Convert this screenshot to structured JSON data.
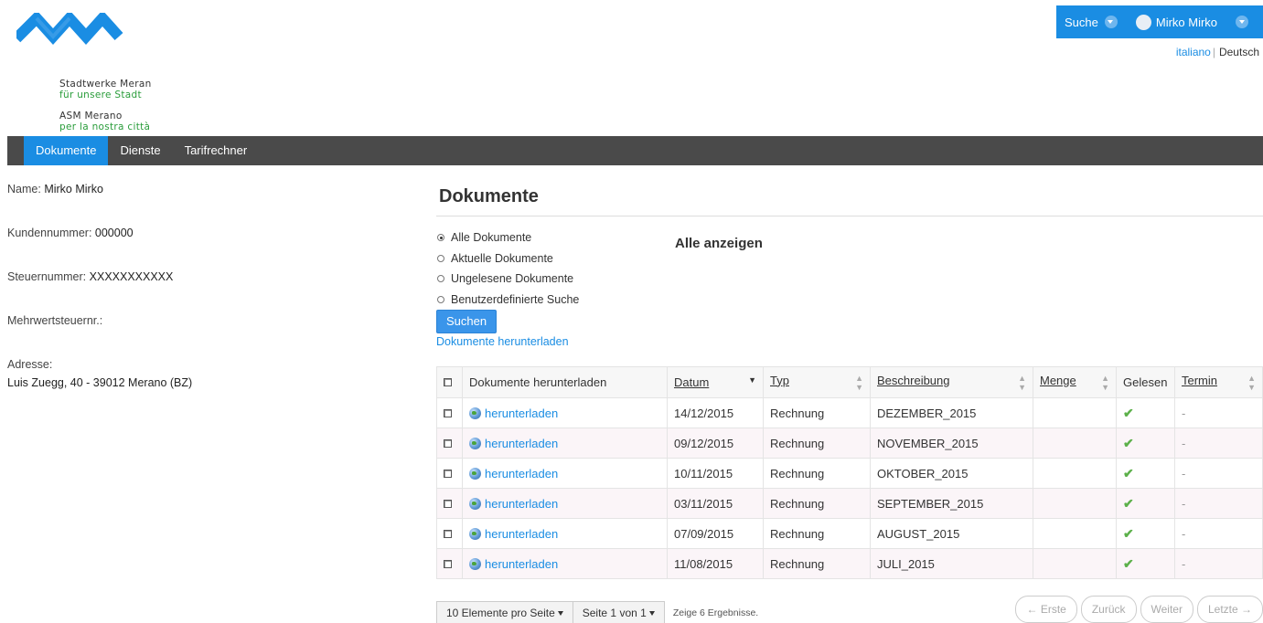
{
  "brand": {
    "line1": "Stadtwerke Meran",
    "line2": "für unsere Stadt",
    "line3": "ASM Merano",
    "line4": "per la nostra città",
    "color_blue": "#1a8de3",
    "color_green": "#2a9d3b"
  },
  "topbar": {
    "search_label": "Suche",
    "user_name": "Mirko Mirko",
    "lang_it": "italiano",
    "lang_de": "Deutsch"
  },
  "nav": {
    "items": [
      "Dokumente",
      "Dienste",
      "Tarifrechner"
    ]
  },
  "customer": {
    "name_label": "Name:",
    "name_value": "Mirko Mirko",
    "customer_no_label": "Kundennummer:",
    "customer_no_value": "000000",
    "tax_no_label": "Steuernummer:",
    "tax_no_value": "XXXXXXXXXXX",
    "vat_label": "Mehrwertsteuernr.:",
    "address_label": "Adresse:",
    "address_value": "Luis Zuegg, 40 - 39012 Merano (BZ)"
  },
  "main": {
    "title": "Dokumente",
    "filters": [
      "Alle Dokumente",
      "Aktuelle Dokumente",
      "Ungelesene Dokumente",
      "Benutzerdefinierte Suche"
    ],
    "selected_filter": "Alle Dokumente",
    "filter_heading": "Alle anzeigen",
    "search_button": "Suchen",
    "download_link": "Dokumente herunterladen"
  },
  "table": {
    "columns": [
      "Dokumente herunterladen",
      "Datum",
      "Typ",
      "Beschreibung",
      "Menge",
      "Gelesen",
      "Termin"
    ],
    "rows": [
      {
        "link": "herunterladen",
        "date": "14/12/2015",
        "type": "Rechnung",
        "desc": "DEZEMBER_2015",
        "qty": "",
        "read": "✔",
        "due": "-"
      },
      {
        "link": "herunterladen",
        "date": "09/12/2015",
        "type": "Rechnung",
        "desc": "NOVEMBER_2015",
        "qty": "",
        "read": "✔",
        "due": "-"
      },
      {
        "link": "herunterladen",
        "date": "10/11/2015",
        "type": "Rechnung",
        "desc": "OKTOBER_2015",
        "qty": "",
        "read": "✔",
        "due": "-"
      },
      {
        "link": "herunterladen",
        "date": "03/11/2015",
        "type": "Rechnung",
        "desc": "SEPTEMBER_2015",
        "qty": "",
        "read": "✔",
        "due": "-"
      },
      {
        "link": "herunterladen",
        "date": "07/09/2015",
        "type": "Rechnung",
        "desc": "AUGUST_2015",
        "qty": "",
        "read": "✔",
        "due": "-"
      },
      {
        "link": "herunterladen",
        "date": "11/08/2015",
        "type": "Rechnung",
        "desc": "JULI_2015",
        "qty": "",
        "read": "✔",
        "due": "-"
      }
    ]
  },
  "pager": {
    "per_page": "10 Elemente pro Seite",
    "page_of": "Seite 1 von 1",
    "results": "Zeige 6 Ergebnisse.",
    "first": "← Erste",
    "prev": "Zurück",
    "next": "Weiter",
    "last": "Letzte →"
  }
}
